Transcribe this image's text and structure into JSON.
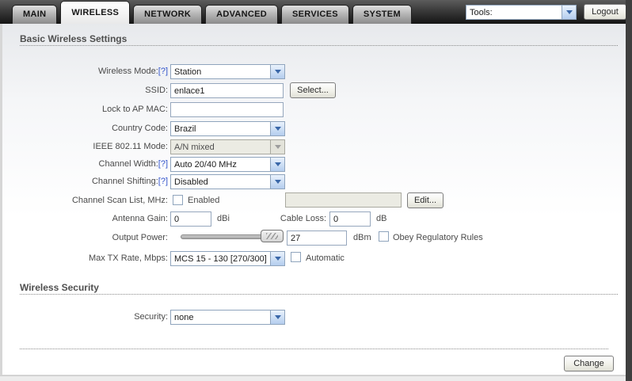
{
  "header": {
    "tabs": [
      {
        "label": "MAIN"
      },
      {
        "label": "WIRELESS"
      },
      {
        "label": "NETWORK"
      },
      {
        "label": "ADVANCED"
      },
      {
        "label": "SERVICES"
      },
      {
        "label": "SYSTEM"
      }
    ],
    "tools_select_value": "Tools:",
    "logout_label": "Logout"
  },
  "basic_section": {
    "title": "Basic Wireless Settings"
  },
  "security_section": {
    "title": "Wireless Security"
  },
  "fields": {
    "wireless_mode": {
      "label": "Wireless Mode:",
      "help": "[?]",
      "value": "Station"
    },
    "ssid": {
      "label": "SSID:",
      "value": "enlace1",
      "select_button": "Select..."
    },
    "lock_to_ap_mac": {
      "label": "Lock to AP MAC:",
      "value": ""
    },
    "country_code": {
      "label": "Country Code:",
      "value": "Brazil"
    },
    "ieee80211_mode": {
      "label": "IEEE 802.11 Mode:",
      "value": "A/N mixed"
    },
    "channel_width": {
      "label": "Channel Width:",
      "help": "[?]",
      "value": "Auto 20/40 MHz"
    },
    "channel_shifting": {
      "label": "Channel Shifting:",
      "help": "[?]",
      "value": "Disabled"
    },
    "channel_scan_list": {
      "label": "Channel Scan List, MHz:",
      "checkbox_label": "Enabled",
      "value": "",
      "edit_button": "Edit..."
    },
    "antenna_gain": {
      "label": "Antenna Gain:",
      "value": "0",
      "unit": "dBi"
    },
    "cable_loss": {
      "label": "Cable Loss:",
      "value": "0",
      "unit": "dB"
    },
    "output_power": {
      "label": "Output Power:",
      "value": "27",
      "unit": "dBm",
      "checkbox_label": "Obey Regulatory Rules"
    },
    "max_tx_rate": {
      "label": "Max TX Rate, Mbps:",
      "value": "MCS 15 - 130 [270/300]",
      "checkbox_label": "Automatic"
    },
    "security": {
      "label": "Security:",
      "value": "none"
    }
  },
  "footer": {
    "change_button": "Change"
  },
  "colors": {
    "accent_blue": "#3a67a8",
    "bar_dark": "#2b2b2b",
    "help_link": "#3355cc"
  }
}
